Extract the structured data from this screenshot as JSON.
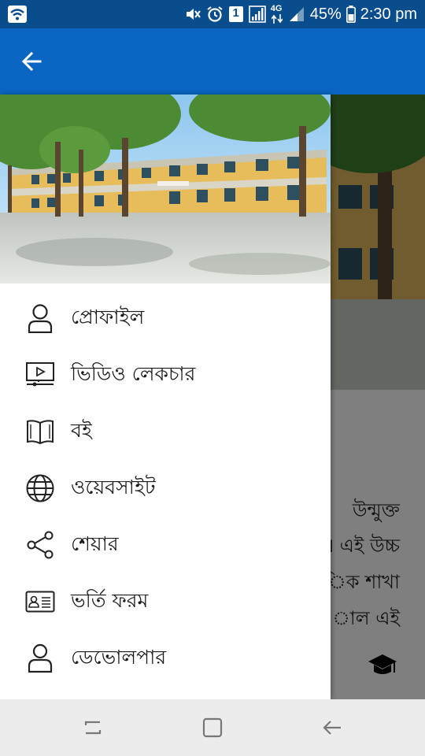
{
  "status_bar": {
    "battery_percent": "45%",
    "time": "2:30 pm",
    "network_type": "4G",
    "sim_slot": "1",
    "icons": [
      "wifi-icon",
      "mute-icon",
      "alarm-icon",
      "sim-icon",
      "signal-icon",
      "data-arrows-icon",
      "battery-icon"
    ]
  },
  "app_bar": {
    "back_icon": "arrow-left-icon"
  },
  "drawer": {
    "header_image": "school-building-photo",
    "items": [
      {
        "label": "প্রোফাইল",
        "icon": "person-icon"
      },
      {
        "label": "ভিডিও লেকচার",
        "icon": "video-lecture-icon"
      },
      {
        "label": "বই",
        "icon": "book-icon"
      },
      {
        "label": "ওয়েবসাইট",
        "icon": "globe-icon"
      },
      {
        "label": "শেয়ার",
        "icon": "share-icon"
      },
      {
        "label": "ভর্তি ফরম",
        "icon": "id-card-icon"
      },
      {
        "label": "ডেভোলপার",
        "icon": "developer-icon"
      }
    ]
  },
  "background_content": {
    "text_lines": [
      "উন্মুক্ত",
      "। এই উচ্চ",
      "িক শাখা",
      "াল এই"
    ],
    "bottom_icon": "graduation-cap-icon"
  },
  "nav_bar": {
    "icons": [
      "recent-apps-icon",
      "home-icon",
      "back-icon"
    ]
  },
  "colors": {
    "status_bar": "#0a4d8c",
    "app_bar": "#0a66c2",
    "drawer_bg": "#ffffff",
    "nav_bar": "#ececec"
  }
}
